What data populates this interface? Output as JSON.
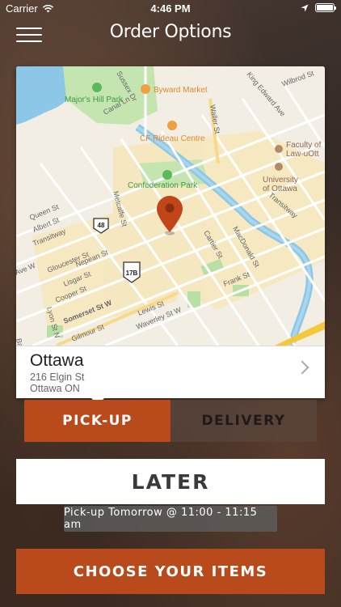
{
  "status_bar": {
    "carrier": "Carrier",
    "time": "4:46 PM"
  },
  "nav": {
    "title": "Order Options"
  },
  "map": {
    "pois": {
      "byward": "Byward Market",
      "majors": "Major's Hill Park",
      "rideau": "CF Rideau Centre",
      "confed": "Confederation Park",
      "faculty1": "Faculty of",
      "faculty2": "Law-uOtt",
      "uni1": "University",
      "uni2": "of Ottawa"
    },
    "streets": {
      "sussex": "Sussex Dr",
      "waller": "Waller St",
      "king_edward": "King Edward Ave",
      "wilbrod": "Wilbrod St",
      "canal": "Canal Ln",
      "queen": "Queen St",
      "albert": "Albert St",
      "transitway": "Transitway",
      "metcalfe": "Metcalfe St",
      "gloucester": "Gloucester St",
      "nepean": "Nepean St",
      "lisgar": "Lisgar St",
      "cooper": "Cooper St",
      "somerset": "Somerset St W",
      "lyon": "Lyon St N",
      "gilmour": "Gilmour St",
      "lewis": "Lewis St",
      "waverley": "Waverley St W",
      "cartier": "Cartier St",
      "macdonald": "MacDonald St",
      "frank": "Frank St",
      "bank": "Bank",
      "transitway2": "Transitway",
      "ave": "Ave W"
    },
    "route_badges": [
      "48",
      "17B"
    ]
  },
  "location": {
    "city": "Ottawa",
    "address": "216 Elgin St",
    "region": "Ottawa ON"
  },
  "mode": {
    "pickup_label": "PICK-UP",
    "delivery_label": "DELIVERY",
    "selected": "pickup"
  },
  "schedule": {
    "later_label": "LATER",
    "pickup_time": "Pick-up Tomorrow @ 11:00 - 11:15 am"
  },
  "cta": {
    "choose_label": "CHOOSE YOUR ITEMS"
  },
  "colors": {
    "accent": "#b94a1b",
    "pin": "#c0461a"
  }
}
